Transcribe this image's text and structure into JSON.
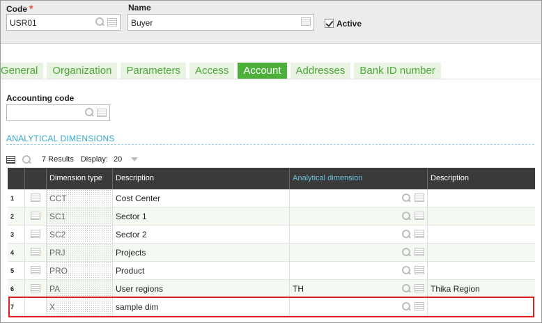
{
  "header": {
    "code_label": "Code",
    "required_mark": "*",
    "code_value": "USR01",
    "name_label": "Name",
    "name_value": "Buyer",
    "active_label": "Active"
  },
  "tabs": [
    "General",
    "Organization",
    "Parameters",
    "Access",
    "Account",
    "Addresses",
    "Bank ID number"
  ],
  "accounting": {
    "label": "Accounting code",
    "value": ""
  },
  "section": {
    "title": "ANALYTICAL DIMENSIONS"
  },
  "toolbar": {
    "results": "7 Results",
    "display_label": "Display:",
    "display_value": "20"
  },
  "grid": {
    "headers": [
      "Dimension type",
      "Description",
      "Analytical dimension",
      "Description"
    ],
    "rows": [
      {
        "num": "1",
        "dim": "CCT",
        "desc": "Cost Center",
        "ad": "",
        "d2": ""
      },
      {
        "num": "2",
        "dim": "SC1",
        "desc": "Sector 1",
        "ad": "",
        "d2": ""
      },
      {
        "num": "3",
        "dim": "SC2",
        "desc": "Sector 2",
        "ad": "",
        "d2": ""
      },
      {
        "num": "4",
        "dim": "PRJ",
        "desc": "Projects",
        "ad": "",
        "d2": ""
      },
      {
        "num": "5",
        "dim": "PRO",
        "desc": "Product",
        "ad": "",
        "d2": ""
      },
      {
        "num": "6",
        "dim": "PA",
        "desc": "User regions",
        "ad": "TH",
        "d2": "Thika Region"
      },
      {
        "num": "7",
        "dim": "X",
        "desc": "sample dim",
        "ad": "",
        "d2": ""
      }
    ]
  },
  "colors": {
    "tab_active": "#4caf3a",
    "tab_text": "#4ea73a",
    "accent_blue": "#32a8c8",
    "highlight": "#e02020"
  }
}
